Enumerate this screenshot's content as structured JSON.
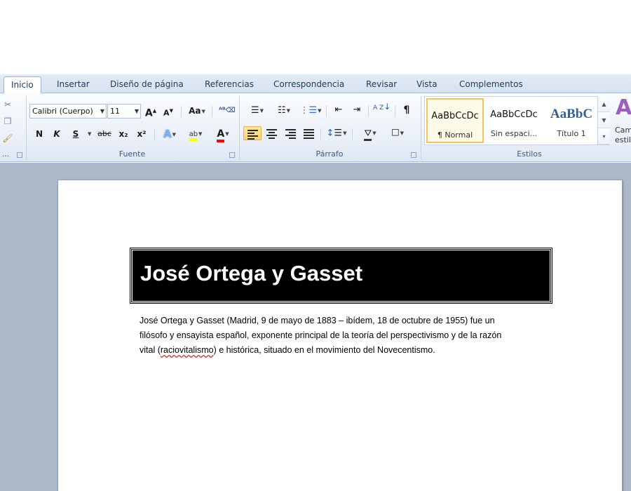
{
  "tabs": [
    "Inicio",
    "Insertar",
    "Diseño de página",
    "Referencias",
    "Correspondencia",
    "Revisar",
    "Vista",
    "Complementos"
  ],
  "font": {
    "name": "Calibri (Cuerpo)",
    "size": "11",
    "group_label": "Fuente",
    "grow": "A",
    "shrink": "A",
    "case": "Aa",
    "bold": "N",
    "italic": "K",
    "underline": "S",
    "strike": "abc",
    "subscript": "x₂",
    "superscript": "x²",
    "text_effects": "A",
    "highlight": "ab",
    "font_color": "A"
  },
  "paragraph": {
    "group_label": "Párrafo",
    "sort": "A Z",
    "pilcrow": "¶"
  },
  "styles": {
    "group_label": "Estilos",
    "items": [
      {
        "sample": "AaBbCcDc",
        "name": "¶ Normal"
      },
      {
        "sample": "AaBbCcDc",
        "name": "Sin espaci..."
      },
      {
        "sample": "AaBbC",
        "name": "Título 1"
      }
    ],
    "change_label_1": "Cam",
    "change_label_2": "estil"
  },
  "document": {
    "title": "José Ortega y Gasset",
    "line1": "José Ortega y Gasset (Madrid, 9 de mayo de 1883 – ibídem, 18 de octubre de 1955) fue un",
    "line2": "filósofo y ensayista español, exponente principal de la teoría del perspectivismo y de la razón",
    "line3_pre": "vital (",
    "line3_misspelled": "raciovitalismo",
    "line3_post": ") e histórica, situado en el movimiento del Novecentismo."
  },
  "clipboard_label": "..."
}
